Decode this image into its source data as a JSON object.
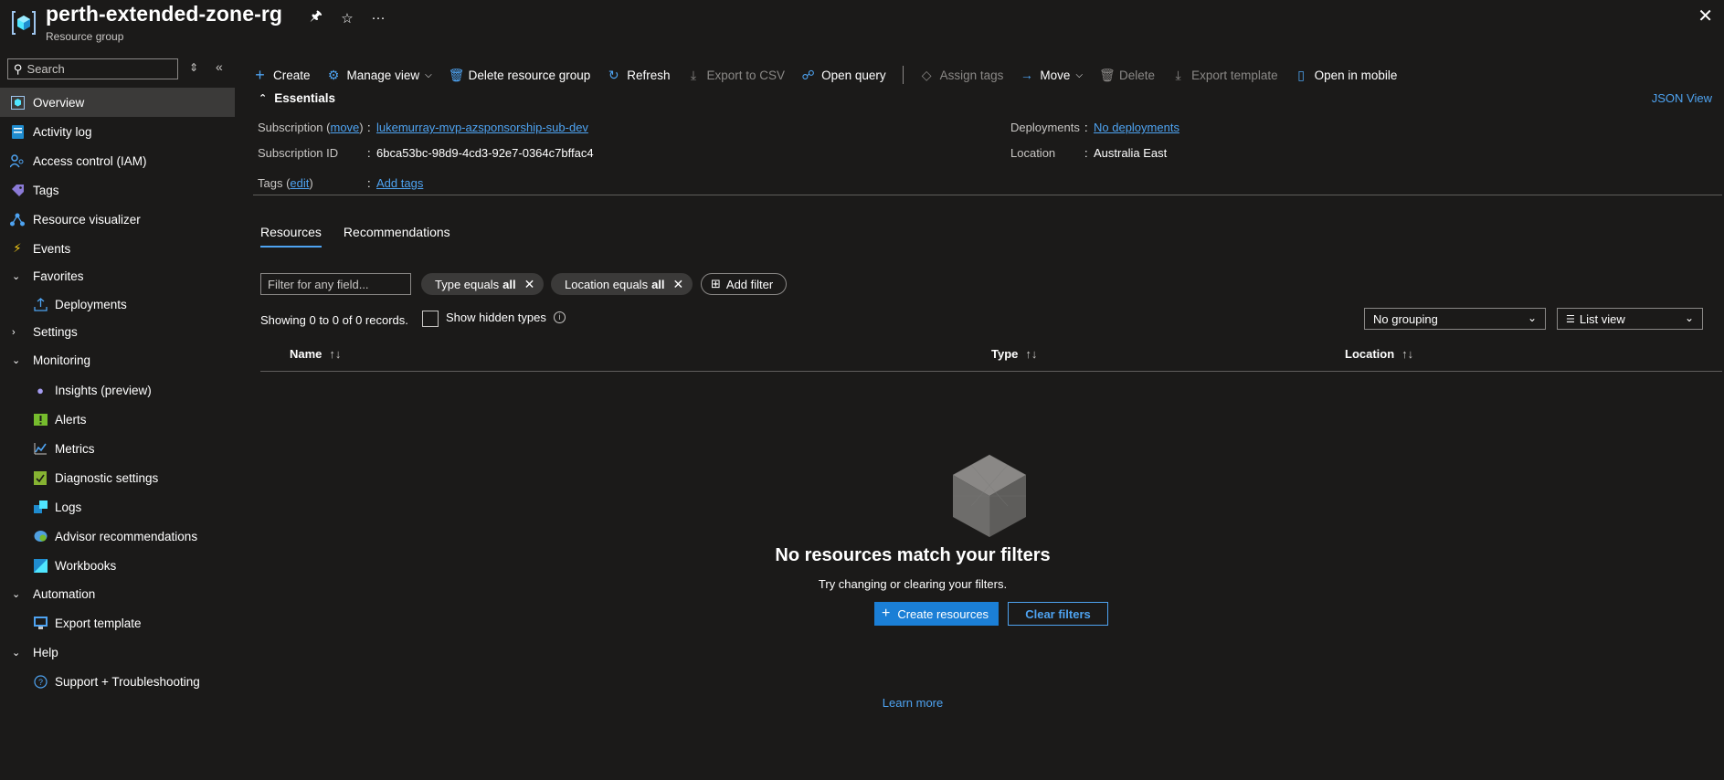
{
  "header": {
    "title": "perth-extended-zone-rg",
    "subtitle": "Resource group",
    "pin_icon": "pin-icon",
    "star_icon": "star-icon",
    "more_icon": "more-icon",
    "close_icon": "close-icon"
  },
  "sidebar": {
    "search_placeholder": "Search",
    "items": [
      {
        "label": "Overview",
        "icon": "overview-icon",
        "active": true
      },
      {
        "label": "Activity log",
        "icon": "activity-log-icon"
      },
      {
        "label": "Access control (IAM)",
        "icon": "iam-icon"
      },
      {
        "label": "Tags",
        "icon": "tag-icon"
      },
      {
        "label": "Resource visualizer",
        "icon": "visualizer-icon"
      },
      {
        "label": "Events",
        "icon": "lightning-icon"
      },
      {
        "label": "Favorites",
        "group": true,
        "expanded": true
      },
      {
        "label": "Deployments",
        "icon": "deployments-icon",
        "sub": true
      },
      {
        "label": "Settings",
        "group": true,
        "expanded": false
      },
      {
        "label": "Monitoring",
        "group": true,
        "expanded": true
      },
      {
        "label": "Insights (preview)",
        "icon": "lightbulb-icon",
        "sub": true
      },
      {
        "label": "Alerts",
        "icon": "alerts-icon",
        "sub": true
      },
      {
        "label": "Metrics",
        "icon": "metrics-icon",
        "sub": true
      },
      {
        "label": "Diagnostic settings",
        "icon": "diagnostic-icon",
        "sub": true
      },
      {
        "label": "Logs",
        "icon": "logs-icon",
        "sub": true
      },
      {
        "label": "Advisor recommendations",
        "icon": "advisor-icon",
        "sub": true
      },
      {
        "label": "Workbooks",
        "icon": "workbooks-icon",
        "sub": true
      },
      {
        "label": "Automation",
        "group": true,
        "expanded": true
      },
      {
        "label": "Export template",
        "icon": "export-template-icon",
        "sub": true
      },
      {
        "label": "Help",
        "group": true,
        "expanded": true
      },
      {
        "label": "Support + Troubleshooting",
        "icon": "help-icon",
        "sub": true
      }
    ]
  },
  "toolbar": {
    "create": "Create",
    "manage_view": "Manage view",
    "delete_rg": "Delete resource group",
    "refresh": "Refresh",
    "export_csv": "Export to CSV",
    "open_query": "Open query",
    "assign_tags": "Assign tags",
    "move": "Move",
    "delete": "Delete",
    "export_template": "Export template",
    "open_mobile": "Open in mobile"
  },
  "essentials": {
    "header": "Essentials",
    "json_view": "JSON View",
    "subscription_label": "Subscription",
    "move_link": "move",
    "subscription_value": "lukemurray-mvp-azsponsorship-sub-dev",
    "subscription_id_label": "Subscription ID",
    "subscription_id_value": "6bca53bc-98d9-4cd3-92e7-0364c7bffac4",
    "tags_label": "Tags",
    "edit_link": "edit",
    "tags_value": "Add tags",
    "deployments_label": "Deployments",
    "deployments_value": "No deployments",
    "location_label": "Location",
    "location_value": "Australia East"
  },
  "tabs": [
    "Resources",
    "Recommendations"
  ],
  "filters": {
    "input_placeholder": "Filter for any field...",
    "type_pill_prefix": "Type equals",
    "type_pill_value": "all",
    "location_pill_prefix": "Location equals",
    "location_pill_value": "all",
    "add_filter": "Add filter"
  },
  "records": {
    "summary": "Showing 0 to 0 of 0 records.",
    "show_hidden": "Show hidden types",
    "grouping": "No grouping",
    "view": "List view"
  },
  "table": {
    "columns": [
      "Name",
      "Type",
      "Location"
    ]
  },
  "empty": {
    "title": "No resources match your filters",
    "subtitle": "Try changing or clearing your filters.",
    "create_btn": "Create resources",
    "clear_btn": "Clear filters",
    "learn_more": "Learn more"
  },
  "colors": {
    "accent": "#4ea3f1",
    "primary_button": "#1b7fd6",
    "background": "#1b1a19",
    "active_nav": "#3b3a39"
  }
}
